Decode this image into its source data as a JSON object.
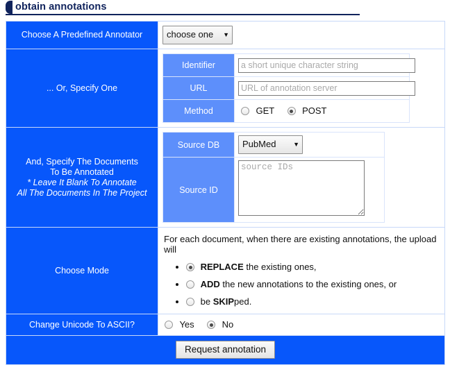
{
  "page": {
    "title": "obtain annotations"
  },
  "rows": {
    "predefined": {
      "label": "Choose A Predefined Annotator",
      "select_value": "choose one",
      "caret": "▼"
    },
    "specify_one": {
      "label": "... Or, Specify One",
      "fields": [
        {
          "label": "Identifier",
          "placeholder": "a short unique character string",
          "value": ""
        },
        {
          "label": "URL",
          "placeholder": "URL of annotation server",
          "value": ""
        }
      ],
      "method": {
        "label": "Method",
        "options": [
          {
            "label": "GET",
            "selected": false
          },
          {
            "label": "POST",
            "selected": true
          }
        ]
      }
    },
    "documents": {
      "label_line1": "And, Specify The Documents",
      "label_line2": "To Be Annotated",
      "label_line3": "* Leave It Blank To Annotate",
      "label_line4": "All The Documents In The Project",
      "source_db": {
        "label": "Source DB",
        "select_value": "PubMed",
        "caret": "▼"
      },
      "source_id": {
        "label": "Source ID",
        "placeholder": "source IDs",
        "value": ""
      }
    },
    "mode": {
      "label": "Choose Mode",
      "intro": "For each document, when there are existing annotations, the upload will",
      "options": [
        {
          "strong": "REPLACE",
          "rest": " the existing ones,",
          "selected": true
        },
        {
          "strong": "ADD",
          "rest": " the new annotations to the existing ones, or",
          "selected": false
        },
        {
          "pre": "be ",
          "strong": "SKIP",
          "rest": "ped.",
          "selected": false
        }
      ]
    },
    "unicode": {
      "label": "Change Unicode To ASCII?",
      "options": [
        {
          "label": "Yes",
          "selected": false
        },
        {
          "label": "No",
          "selected": true
        }
      ]
    },
    "submit": {
      "label": "Request annotation"
    }
  },
  "colors": {
    "primary_blue": "#0757fb",
    "sub_blue": "#5d8ffb",
    "navy": "#10235c",
    "border": "#c8d8f8"
  }
}
